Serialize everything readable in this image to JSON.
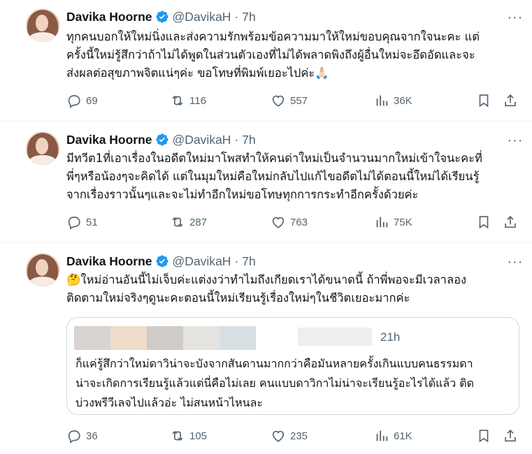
{
  "tweets": [
    {
      "name": "Davika Hoorne",
      "handle": "@DavikaH",
      "separator": "·",
      "time": "7h",
      "lines": [
        "ทุกคนบอกให้ใหม่นิ่งและส่งความรักพร้อมข้อความมาให้ใหม่ขอบคุณจากใจนะคะ แต่",
        "ครั้งนี้ใหม่รู้สึกว่าถ้าไม่ได้พูดในส่วนตัวเองที่ไม่ได้พลาดพิงถึงผู้อื่นใหม่จะอึดอัดและจะ",
        "ส่งผลต่อสุขภาพจิตแน่ๆค่ะ ขอโทษที่พิมพ์เยอะไปค่ะ🙏🏻"
      ],
      "replies": "69",
      "reposts": "116",
      "likes": "557",
      "views": "36K"
    },
    {
      "name": "Davika Hoorne",
      "handle": "@DavikaH",
      "separator": "·",
      "time": "7h",
      "lines": [
        "มีทวีต1ที่เอาเรื่องในอดีตใหม่มาโพสทำให้คนด่าใหม่เป็นจำนวนมากใหม่เข้าใจนะคะที่",
        "พี่ๆหรือน้องๆจะคิดได้ แต่ในมุมใหม่คือใหม่กลับไปแก้ไขอดีตไม่ได้ตอนนี้ใหม่ได้เรียนรู้",
        "จากเรื่องราวนั้นๆและจะไม่ทำอีกใหม่ขอโทษทุกการกระทำอีกครั้งด้วยค่ะ"
      ],
      "replies": "51",
      "reposts": "287",
      "likes": "763",
      "views": "75K"
    },
    {
      "name": "Davika Hoorne",
      "handle": "@DavikaH",
      "separator": "·",
      "time": "7h",
      "lines": [
        "🤔ใหม่อ่านอันนี้ไม่เจ็บค่ะแต่งงว่าทำไมถึงเกียดเราได้ขนาดนี้ ถ้าพี่พอจะมีเวลาลอง",
        "ติดตามใหม่จริงๆดูนะคะตอนนี้ใหม่เรียนรู้เรื่องใหม่ๆในชีวิตเยอะมากค่ะ"
      ],
      "quote": {
        "time": "21h",
        "lines": [
          "ก็แค่รู้สึกว่าใหม่ดาวิน่าจะบังจากสันดานมากกว่าคือมันหลายครั้งเกินแบบคนธรรมดา",
          "น่าจะเกิดการเรียนรู้แล้วแต่นี่คือไม่เลย คนแบบดาวิกาไม่น่าจะเรียนรู้อะไรได้แล้ว ติด",
          "บ่วงพรีวีเลจไปแล้วอ่ะ ไม่สนหน้าไหนละ"
        ]
      },
      "replies": "36",
      "reposts": "105",
      "likes": "235",
      "views": "61K"
    }
  ],
  "icons": {
    "more": "more-icon",
    "verified": "verified-badge-icon",
    "reply": "reply-icon",
    "repost": "repost-icon",
    "like": "like-icon",
    "views": "views-icon",
    "bookmark": "bookmark-icon",
    "share": "share-icon"
  },
  "colors": {
    "verified": "#1d9bf0",
    "muted": "#536471",
    "text": "#0f1419",
    "divider": "#eff3f4"
  }
}
